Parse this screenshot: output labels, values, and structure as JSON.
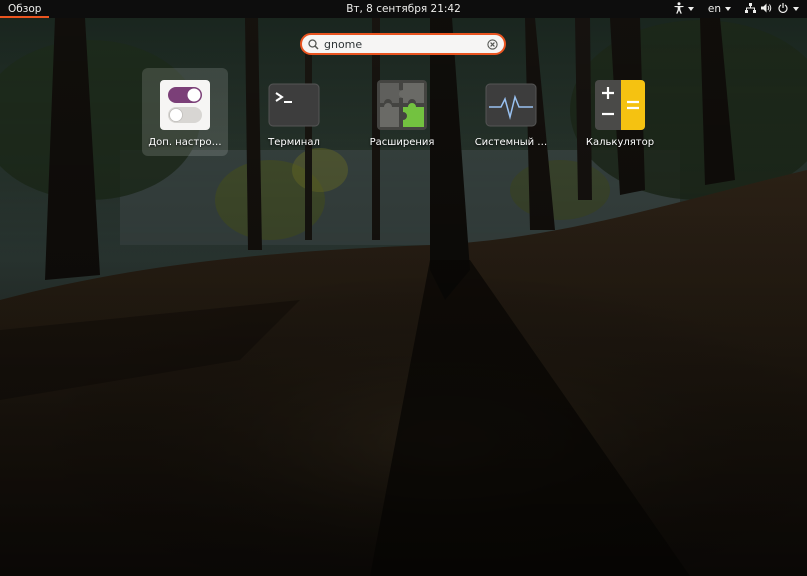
{
  "topbar": {
    "activities_label": "Обзор",
    "clock": "Вт, 8 сентября  21:42",
    "keyboard_layout": "en",
    "icons": [
      "accessibility-icon",
      "network-icon",
      "volume-icon",
      "power-icon"
    ]
  },
  "search": {
    "value": "gnome",
    "clear_icon": "clear-icon"
  },
  "apps": [
    {
      "label": "Доп. настро…",
      "icon": "tweaks-icon",
      "selected": true
    },
    {
      "label": "Терминал",
      "icon": "terminal-icon",
      "selected": false
    },
    {
      "label": "Расширения",
      "icon": "extensions-icon",
      "selected": false
    },
    {
      "label": "Системный …",
      "icon": "system-monitor-icon",
      "selected": false
    },
    {
      "label": "Калькулятор",
      "icon": "calculator-icon",
      "selected": false
    }
  ],
  "colors": {
    "accent": "#e95420",
    "topbar": "#0d0d0d",
    "tweaks_purple": "#7b3f78",
    "extensions_green": "#73c240",
    "calculator_yellow": "#f5c211"
  }
}
